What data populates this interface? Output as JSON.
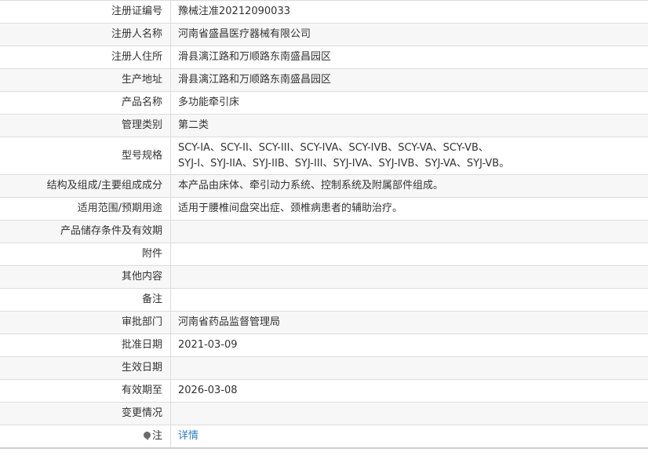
{
  "rows": [
    {
      "label": "注册证编号",
      "value": "豫械注准20212090033"
    },
    {
      "label": "注册人名称",
      "value": "河南省盛昌医疗器械有限公司"
    },
    {
      "label": "注册人住所",
      "value": "滑县漓江路和万顺路东南盛昌园区"
    },
    {
      "label": "生产地址",
      "value": "滑县漓江路和万顺路东南盛昌园区"
    },
    {
      "label": "产品名称",
      "value": "多功能牵引床"
    },
    {
      "label": "管理类别",
      "value": "第二类"
    },
    {
      "label": "型号规格",
      "value_line1": "SCY-IA、SCY-II、SCY-III、SCY-IVA、SCY-IVB、SCY-VA、SCY-VB、",
      "value_line2": "SYJ-I、SYJ-IIA、SYJ-IIB、SYJ-III、SYJ-IVA、SYJ-IVB、SYJ-VA、SYJ-VB。"
    },
    {
      "label": "结构及组成/主要组成成分",
      "value": "本产品由床体、牵引动力系统、控制系统及附属部件组成。"
    },
    {
      "label": "适用范围/预期用途",
      "value": "适用于腰椎间盘突出症、颈椎病患者的辅助治疗。"
    },
    {
      "label": "产品储存条件及有效期",
      "value": ""
    },
    {
      "label": "附件",
      "value": ""
    },
    {
      "label": "其他内容",
      "value": ""
    },
    {
      "label": "备注",
      "value": ""
    },
    {
      "label": "审批部门",
      "value": "河南省药品监督管理局"
    },
    {
      "label": "批准日期",
      "value": "2021-03-09"
    },
    {
      "label": "生效日期",
      "value": ""
    },
    {
      "label": "有效期至",
      "value": "2026-03-08"
    },
    {
      "label": "变更情况",
      "value": ""
    },
    {
      "label": "注",
      "value": "详情",
      "icon": "note-pin-icon"
    }
  ],
  "colors": {
    "link": "#2f7fc1",
    "stripe": "#f7f7f7",
    "border": "#dcdcdc"
  }
}
